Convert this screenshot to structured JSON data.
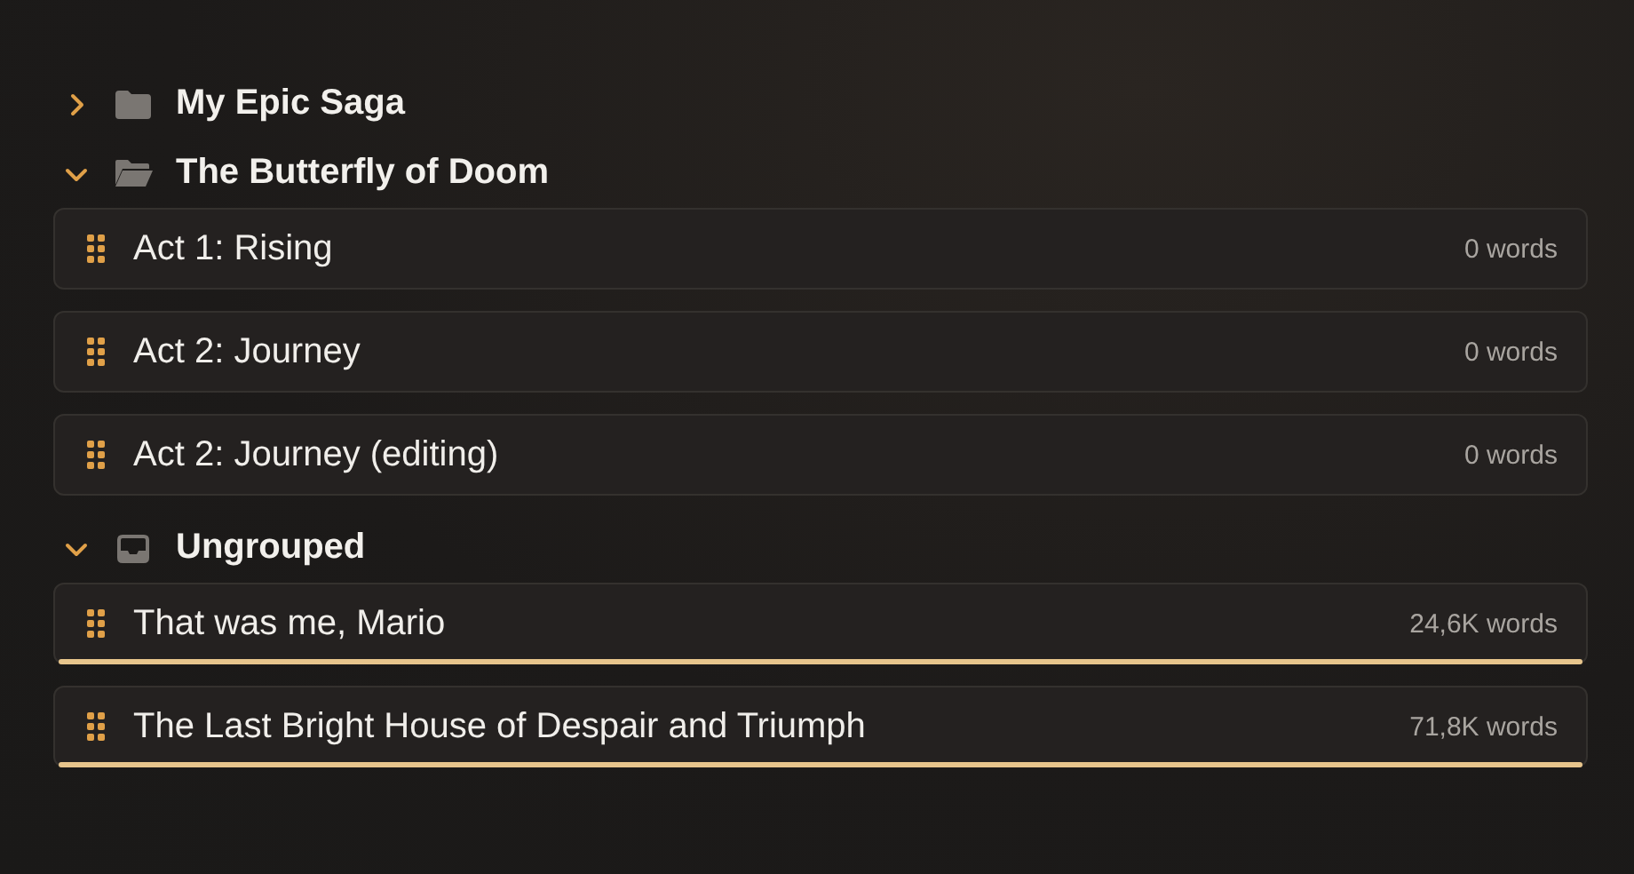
{
  "groups": [
    {
      "title": "My Epic Saga",
      "kind": "folder",
      "expanded": false
    },
    {
      "title": "The Butterfly of Doom",
      "kind": "folder",
      "expanded": true,
      "items": [
        {
          "title": "Act 1: Rising",
          "count": "0 words"
        },
        {
          "title": "Act 2: Journey",
          "count": "0 words"
        },
        {
          "title": "Act 2: Journey (editing)",
          "count": "0 words"
        }
      ]
    },
    {
      "title": "Ungrouped",
      "kind": "inbox",
      "expanded": true,
      "items": [
        {
          "title": "That was me, Mario",
          "count": "24,6K words",
          "level": 1
        },
        {
          "title": "The Last Bright House of Despair and Triumph",
          "count": "71,8K words",
          "level": 1
        }
      ]
    }
  ]
}
